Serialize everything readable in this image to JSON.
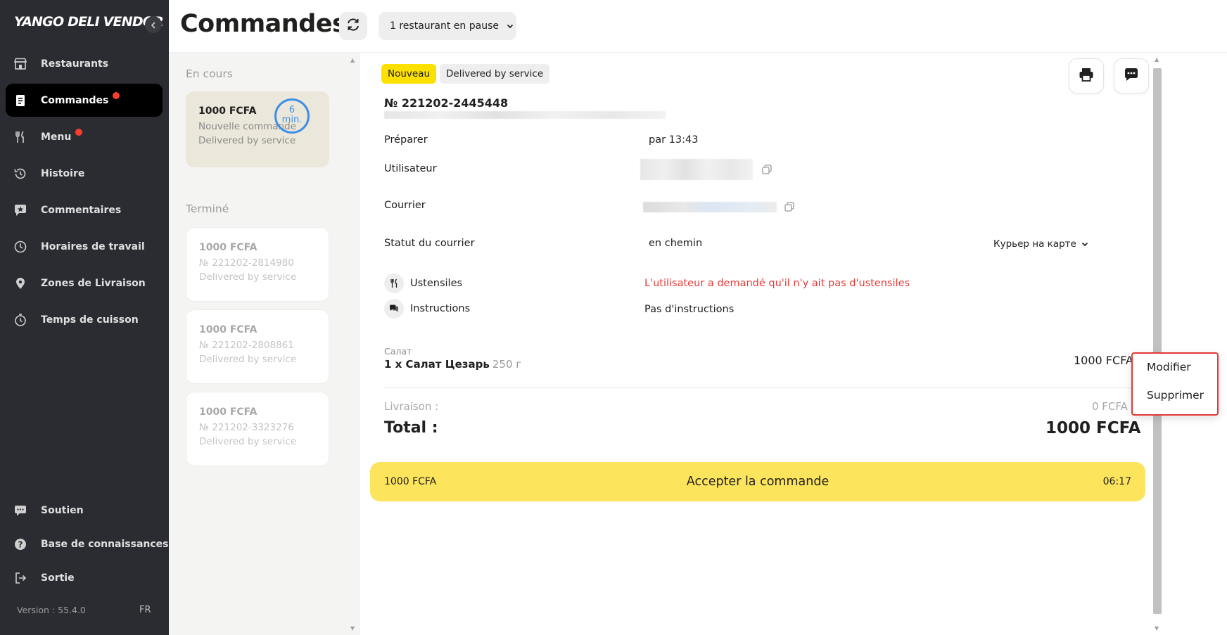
{
  "sidebar": {
    "logo": "YANGO DELI VENDOR",
    "items": [
      {
        "label": "Restaurants",
        "icon": "store-icon"
      },
      {
        "label": "Commandes",
        "icon": "orders-icon",
        "badge": true,
        "active": true
      },
      {
        "label": "Menu",
        "icon": "fork-knife-icon",
        "badge": true
      },
      {
        "label": "Histoire",
        "icon": "history-icon"
      },
      {
        "label": "Commentaires",
        "icon": "comment-star-icon"
      },
      {
        "label": "Horaires de travail",
        "icon": "clock-icon"
      },
      {
        "label": "Zones de Livraison",
        "icon": "location-pin-icon"
      },
      {
        "label": "Temps de cuisson",
        "icon": "stopwatch-icon"
      }
    ],
    "bottom_items": [
      {
        "label": "Soutien",
        "icon": "support-chat-icon"
      },
      {
        "label": "Base de connaissances",
        "icon": "help-icon"
      },
      {
        "label": "Sortie",
        "icon": "logout-icon"
      }
    ],
    "version": "Version : 55.4.0",
    "lang": "FR",
    "badge_color": "#fa3e2c"
  },
  "header": {
    "title": "Commandes",
    "pause_label": "1 restaurant en pause"
  },
  "orders": {
    "in_progress_label": "En cours",
    "current": {
      "amount": "1000 FCFA",
      "status": "Nouvelle commande",
      "service": "Delivered by service",
      "timer_value": "6",
      "timer_unit": "min."
    },
    "done_label": "Terminé",
    "done": [
      {
        "amount": "1000 FCFA",
        "number": "№ 221202-2814980",
        "service": "Delivered by service"
      },
      {
        "amount": "1000 FCFA",
        "number": "№ 221202-2808861",
        "service": "Delivered by service"
      },
      {
        "amount": "1000 FCFA",
        "number": "№ 221202-3323276",
        "service": "Delivered by service"
      }
    ]
  },
  "details": {
    "badge_new": "Nouveau",
    "badge_service": "Delivered by service",
    "order_number": "№ 221202-2445448",
    "rows": {
      "prepare_label": "Préparer",
      "prepare_value": "par 13:43",
      "user_label": "Utilisateur",
      "courier_label": "Courrier",
      "courier_status_label": "Statut du courrier",
      "courier_status_value": "en chemin",
      "map_toggle": "Курьер на карте"
    },
    "utensils_label": "Ustensiles",
    "utensils_value": "L'utilisateur a demandé qu'il n'y ait pas d'ustensiles",
    "instructions_label": "Instructions",
    "instructions_value": "Pas d'instructions",
    "item": {
      "category": "Салат",
      "name": "1 x Салат Цезарь",
      "weight": "250 г",
      "price": "1000 FCFA"
    },
    "delivery_label": "Livraison :",
    "delivery_value": "0 FCFA",
    "total_label": "Total :",
    "total_value": "1000 FCFA",
    "accept": {
      "amount": "1000 FCFA",
      "label": "Accepter la commande",
      "time": "06:17"
    }
  },
  "context_menu": {
    "items": [
      "Modifier",
      "Supprimer"
    ]
  },
  "colors": {
    "accent_yellow": "#fce000",
    "accept_yellow": "#fce45c",
    "warning_red": "#e53935",
    "timer_blue": "#3d90e8",
    "sidebar_bg": "#2b2c31"
  }
}
